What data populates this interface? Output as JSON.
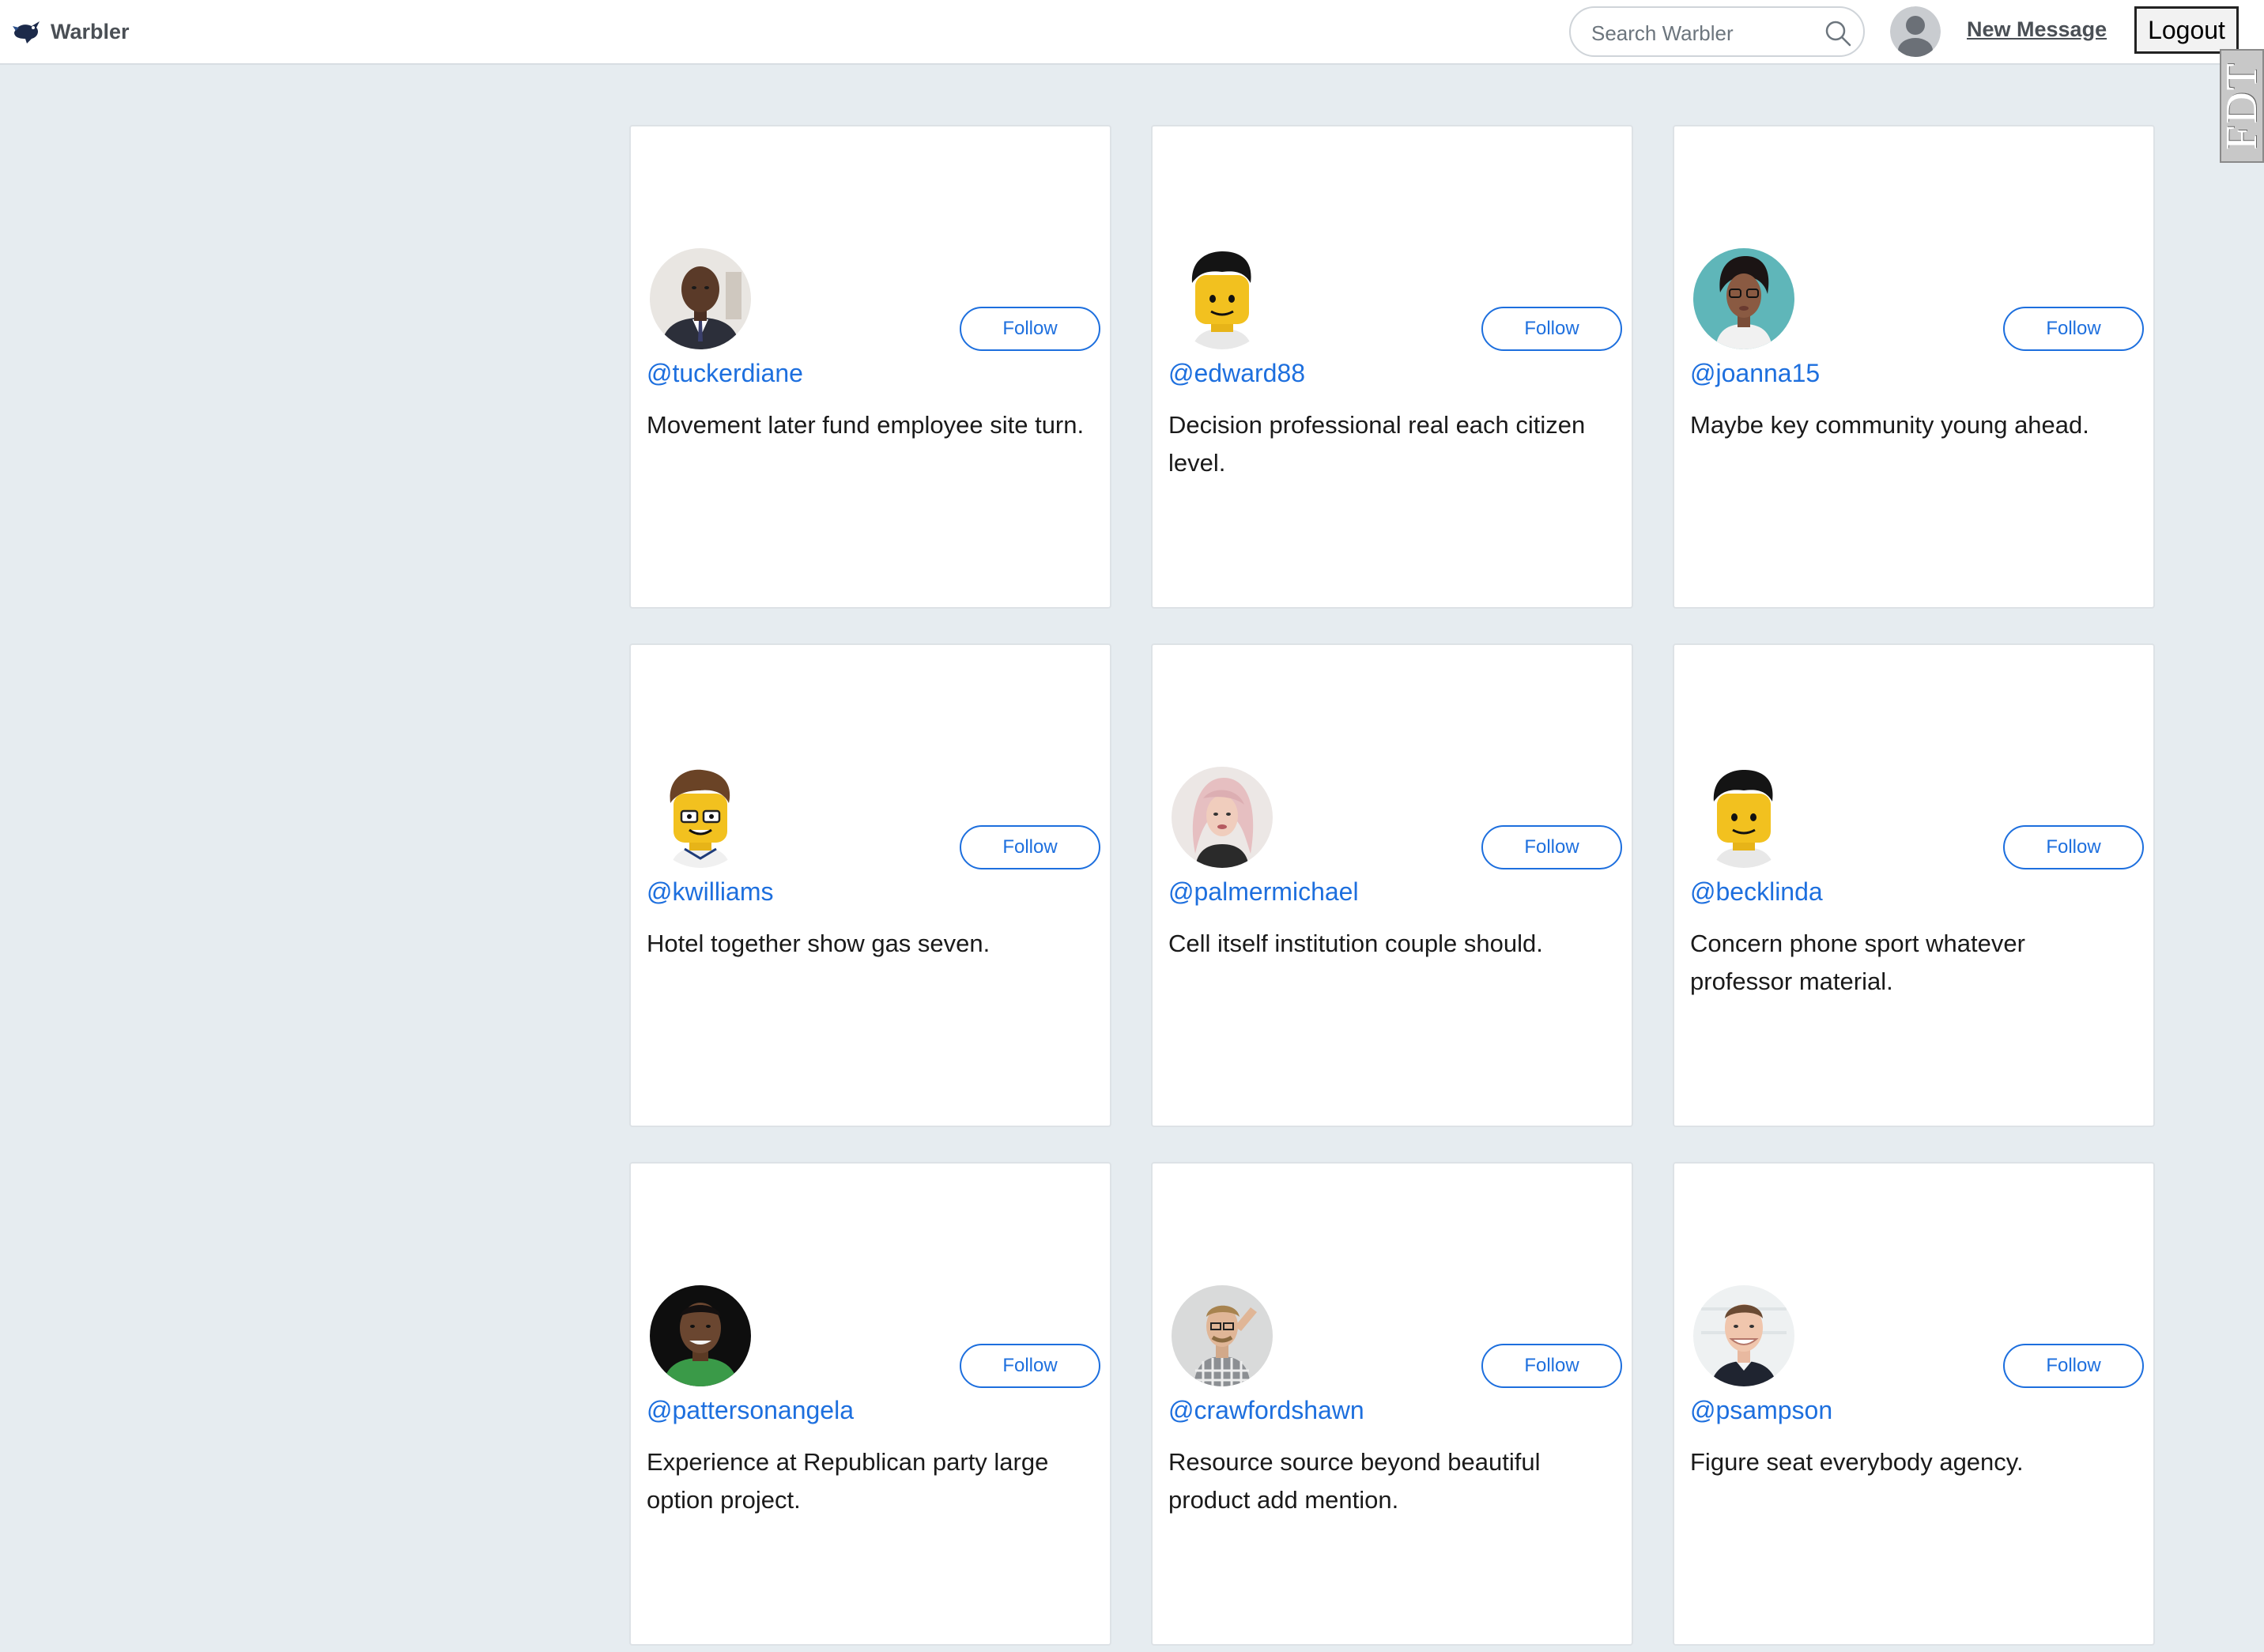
{
  "navbar": {
    "brand": "Warbler",
    "search_placeholder": "Search Warbler",
    "new_message": "New Message",
    "logout": "Logout",
    "debug_tab": "FDT"
  },
  "follow_label": "Follow",
  "users": [
    {
      "handle": "@tuckerdiane",
      "bio": "Movement later fund employee site turn.",
      "avatar": "photo-man-suit"
    },
    {
      "handle": "@edward88",
      "bio": "Decision professional real each citizen level.",
      "avatar": "lego-black-hair"
    },
    {
      "handle": "@joanna15",
      "bio": "Maybe key community young ahead.",
      "avatar": "photo-woman-glasses"
    },
    {
      "handle": "@kwilliams",
      "bio": "Hotel together show gas seven.",
      "avatar": "lego-brown-hair-glasses"
    },
    {
      "handle": "@palmermichael",
      "bio": "Cell itself institution couple should.",
      "avatar": "photo-woman-pink-hair"
    },
    {
      "handle": "@becklinda",
      "bio": "Concern phone sport whatever professor material.",
      "avatar": "lego-black-hair"
    },
    {
      "handle": "@pattersonangela",
      "bio": "Experience at Republican party large option project.",
      "avatar": "photo-man-green-shirt"
    },
    {
      "handle": "@crawfordshawn",
      "bio": "Resource source beyond beautiful product add mention.",
      "avatar": "photo-man-plaid-shirt"
    },
    {
      "handle": "@psampson",
      "bio": "Figure seat everybody agency.",
      "avatar": "photo-man-smiling"
    }
  ],
  "colors": {
    "accent": "#1d6fde",
    "page_background": "#e6ecf0",
    "card_background": "#ffffff"
  }
}
